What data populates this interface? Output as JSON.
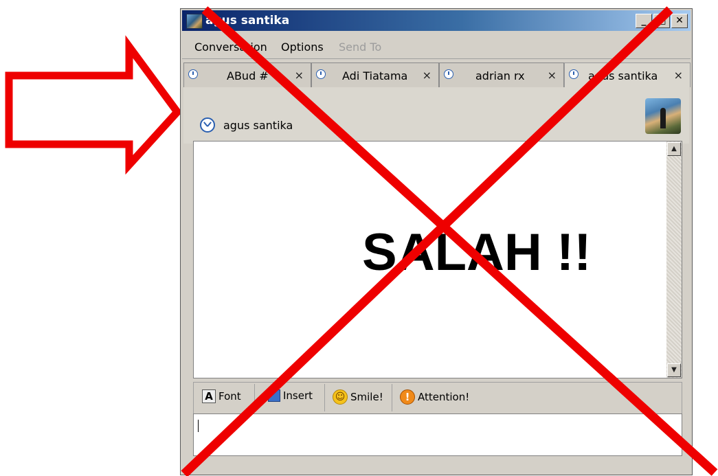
{
  "window": {
    "title": "agus santika",
    "buttons": {
      "minimize": "_",
      "maximize": "□",
      "close": "✕"
    }
  },
  "menu": {
    "conversation": "Conversation",
    "options": "Options",
    "send_to": "Send To"
  },
  "tabs": [
    {
      "label": "ABud #",
      "close": "×"
    },
    {
      "label": "Adi Tiatama",
      "close": "×"
    },
    {
      "label": "adrian rx",
      "close": "×"
    },
    {
      "label": "agus santika",
      "close": "×"
    }
  ],
  "conversation": {
    "buddy_name": "agus santika"
  },
  "overlay": {
    "text": "SALAH !!",
    "color": "#ee0000"
  },
  "toolbar": {
    "font": "Font",
    "insert": "Insert",
    "smile": "Smile!",
    "attention": "Attention!"
  },
  "icons": [
    "clock-icon",
    "font-icon",
    "insert-icon",
    "smile-icon",
    "attention-icon",
    "close-icon"
  ]
}
